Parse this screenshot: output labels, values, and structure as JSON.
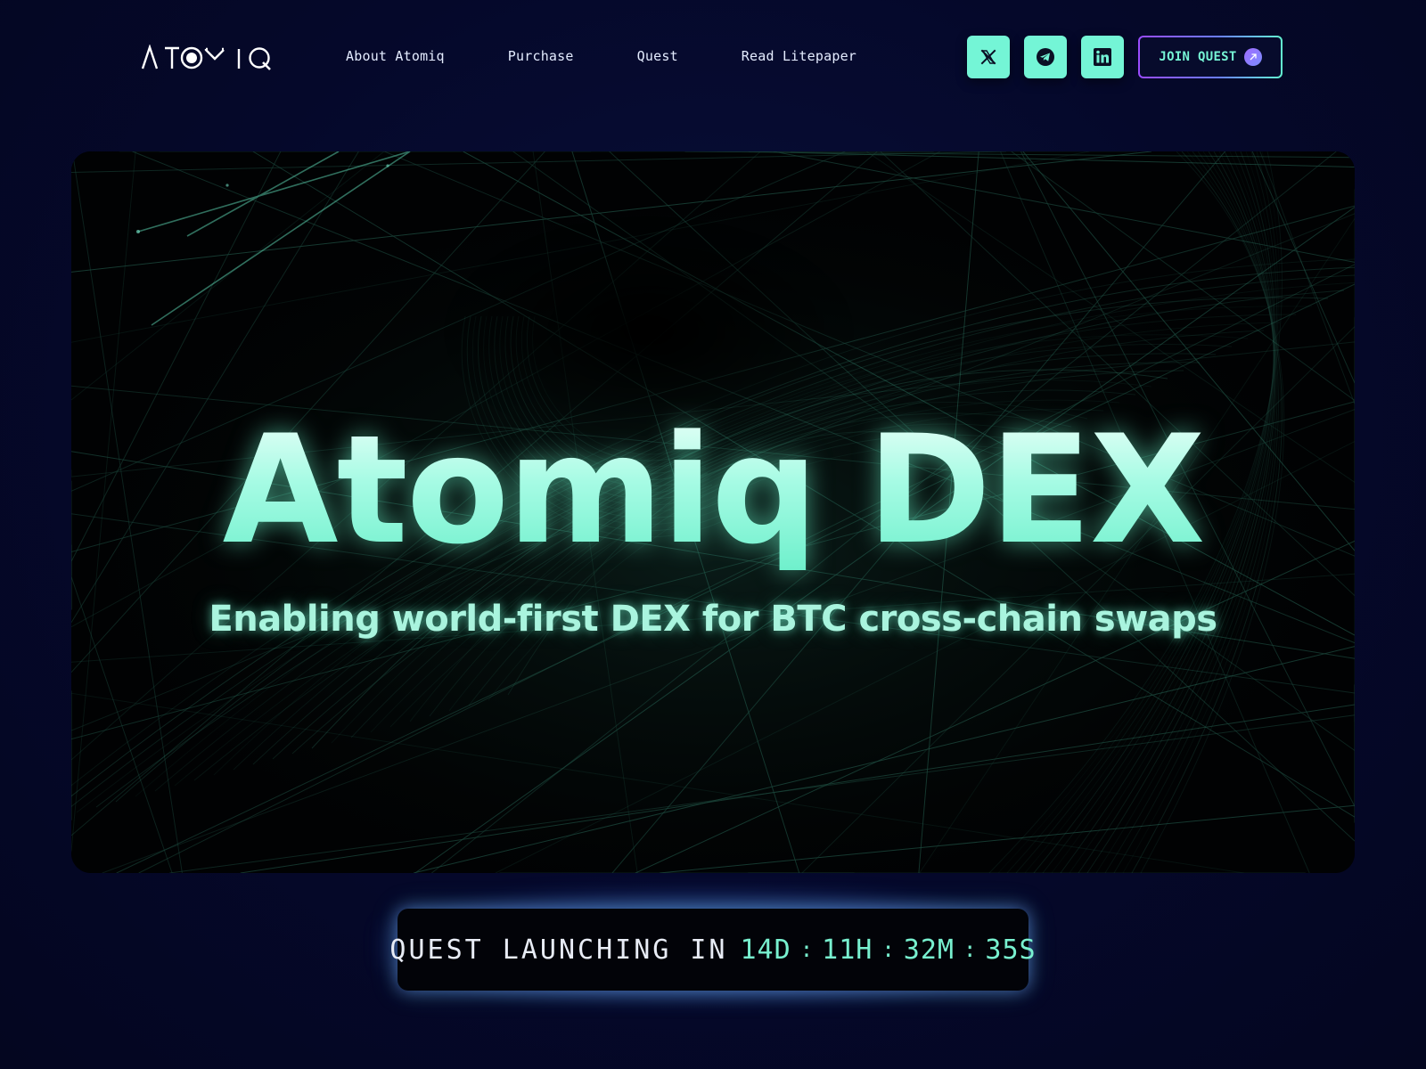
{
  "brand": {
    "logo_text": "ATOMIQ"
  },
  "nav": {
    "items": [
      {
        "label": "About Atomiq"
      },
      {
        "label": "Purchase"
      },
      {
        "label": "Quest"
      },
      {
        "label": "Read Litepaper"
      }
    ]
  },
  "social": [
    {
      "icon": "x-icon"
    },
    {
      "icon": "telegram-icon"
    },
    {
      "icon": "linkedin-icon"
    }
  ],
  "header": {
    "join_label": "JOIN QUEST"
  },
  "hero": {
    "title": "Atomiq DEX",
    "subtitle": "Enabling world-first DEX for BTC cross-chain swaps"
  },
  "countdown": {
    "label": "QUEST LAUNCHING IN",
    "days": "14D",
    "hours": "11H",
    "minutes": "32M",
    "seconds": "35S",
    "separator": ":"
  },
  "colors": {
    "background": "#05082a",
    "accent_mint": "#74f5d6",
    "accent_purple": "#9a4bff",
    "countdown_bg": "#020308"
  }
}
